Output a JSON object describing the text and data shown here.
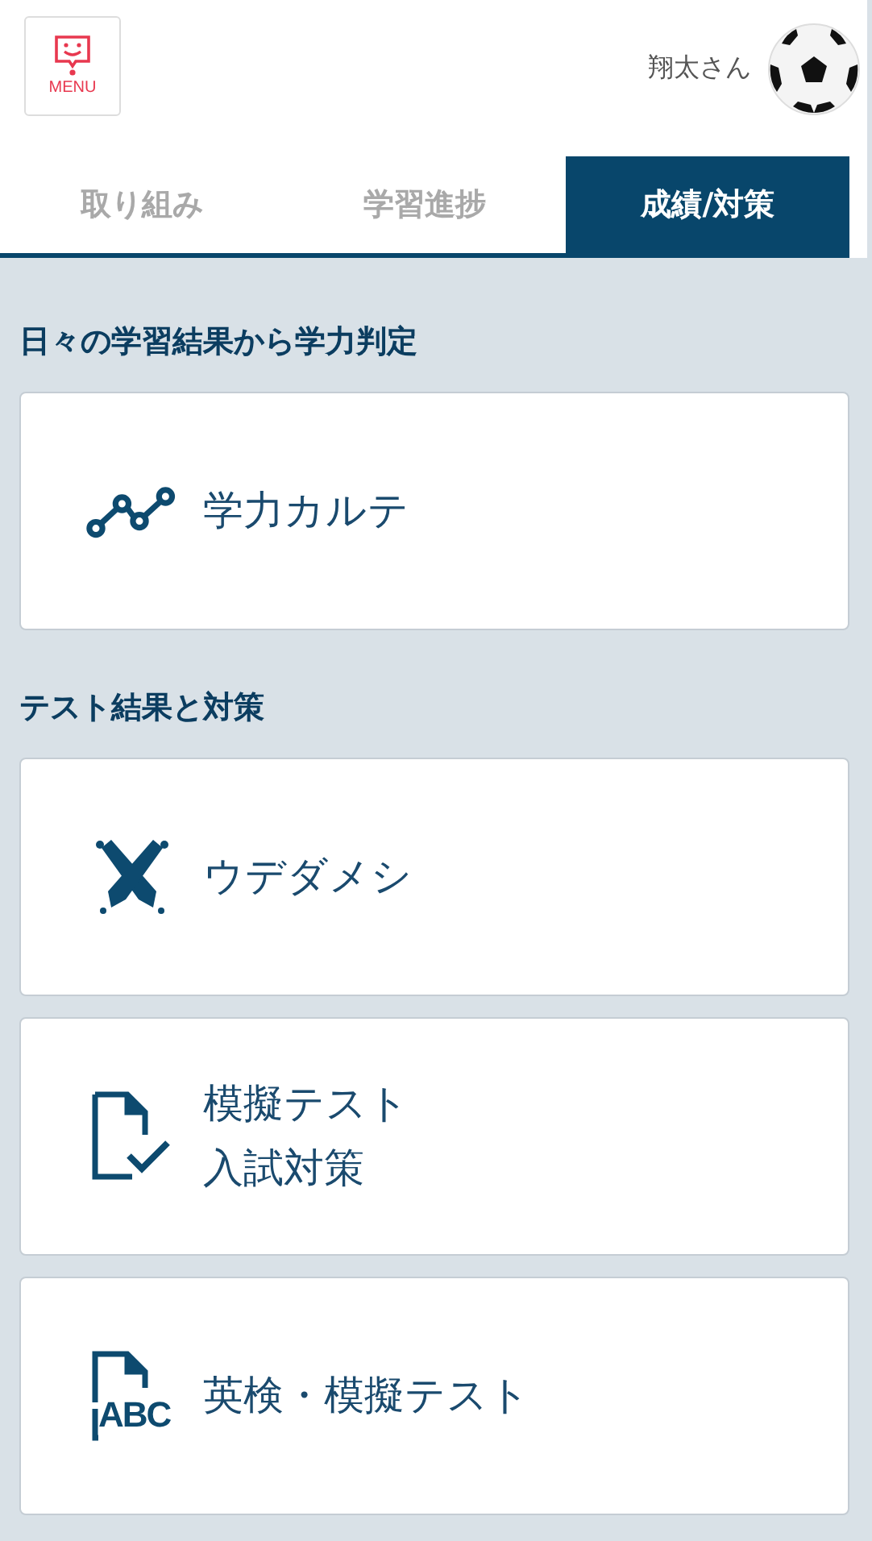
{
  "header": {
    "menu_label": "MENU",
    "user_name": "翔太さん"
  },
  "tabs": [
    {
      "label": "取り組み",
      "selected": false
    },
    {
      "label": "学習進捗",
      "selected": false
    },
    {
      "label": "成績/対策",
      "selected": true
    }
  ],
  "sections": [
    {
      "heading": "日々の学習結果から学力判定",
      "cards": [
        {
          "kind": "chart",
          "lines": [
            "学力カルテ"
          ]
        }
      ]
    },
    {
      "heading": "テスト結果と対策",
      "cards": [
        {
          "kind": "pencils",
          "lines": [
            "ウデダメシ"
          ]
        },
        {
          "kind": "doc-check",
          "lines": [
            "模擬テスト",
            "入試対策"
          ]
        },
        {
          "kind": "doc-abc",
          "icon_text": "ABC",
          "lines": [
            "英検・模擬テスト"
          ]
        }
      ]
    }
  ]
}
